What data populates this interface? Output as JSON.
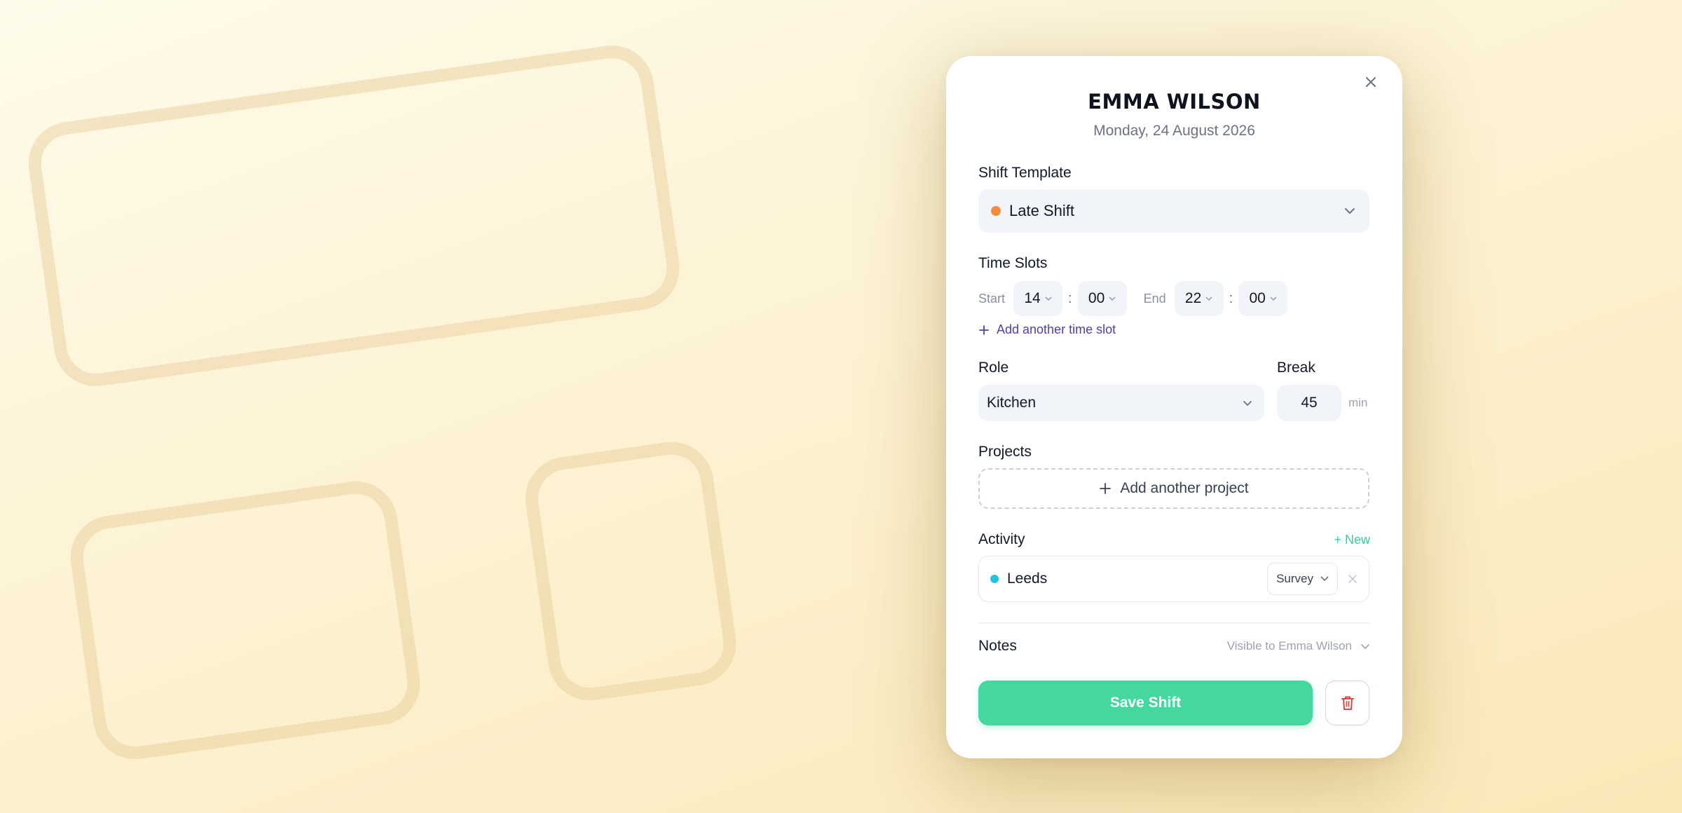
{
  "modal": {
    "employee_name": "EMMA WILSON",
    "date": "Monday, 24 August 2026"
  },
  "shift_template": {
    "label": "Shift Template",
    "value": "Late Shift",
    "dot_color": "#f28c3b"
  },
  "time_slots": {
    "label": "Time Slots",
    "start_label": "Start",
    "start_hour": "14",
    "start_minute": "00",
    "end_label": "End",
    "end_hour": "22",
    "end_minute": "00",
    "separator": ":",
    "add_slot": "Add another time slot"
  },
  "role": {
    "label": "Role",
    "value": "Kitchen"
  },
  "break": {
    "label": "Break",
    "value": "45",
    "unit": "min"
  },
  "projects": {
    "label": "Projects",
    "add_project": "Add another project"
  },
  "activity": {
    "label": "Activity",
    "new_link": "+ New",
    "item_name": "Leeds",
    "item_dot_color": "#22c3e0",
    "item_type": "Survey"
  },
  "notes": {
    "label": "Notes",
    "visibility": "Visible to Emma Wilson"
  },
  "actions": {
    "save_label": "Save Shift"
  },
  "colors": {
    "accent": "#44d89e",
    "link": "#4e3fa8",
    "danger": "#d04a4a"
  }
}
